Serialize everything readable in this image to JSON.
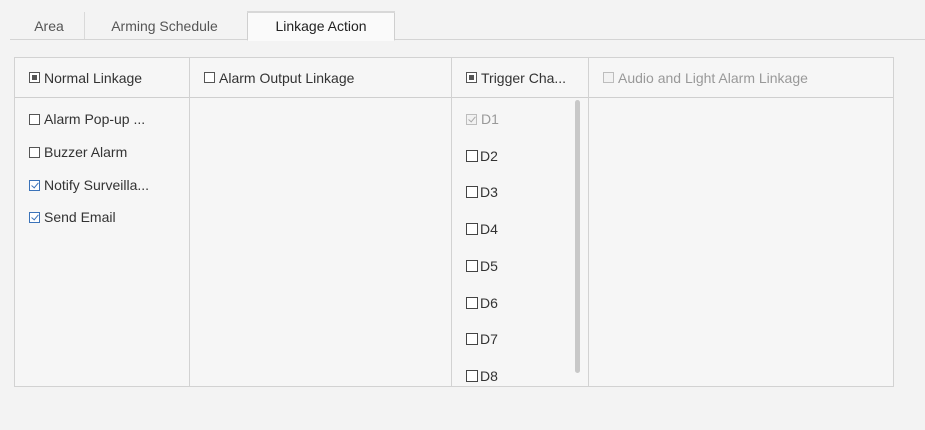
{
  "tabs": [
    {
      "label": "Area"
    },
    {
      "label": "Arming Schedule"
    },
    {
      "label": "Linkage Action"
    }
  ],
  "normal_linkage": {
    "header": "Normal Linkage",
    "items": [
      {
        "label": "Alarm Pop-up ...",
        "checked": false
      },
      {
        "label": "Buzzer Alarm",
        "checked": false
      },
      {
        "label": "Notify Surveilla...",
        "checked": true
      },
      {
        "label": "Send Email",
        "checked": true
      }
    ]
  },
  "alarm_output_linkage": {
    "header": "Alarm Output Linkage"
  },
  "trigger_channel": {
    "header": "Trigger Cha...",
    "channels": [
      {
        "label": "D1",
        "checked": true,
        "disabled": true
      },
      {
        "label": "D2",
        "checked": false
      },
      {
        "label": "D3",
        "checked": false
      },
      {
        "label": "D4",
        "checked": false
      },
      {
        "label": "D5",
        "checked": false
      },
      {
        "label": "D6",
        "checked": false
      },
      {
        "label": "D7",
        "checked": false
      },
      {
        "label": "D8",
        "checked": false
      }
    ]
  },
  "audio_light_linkage": {
    "header": "Audio and Light Alarm Linkage",
    "disabled": true
  },
  "colors": {
    "accent": "#3b73b9",
    "border": "#d2d2d2",
    "background": "#f3f3f3"
  }
}
